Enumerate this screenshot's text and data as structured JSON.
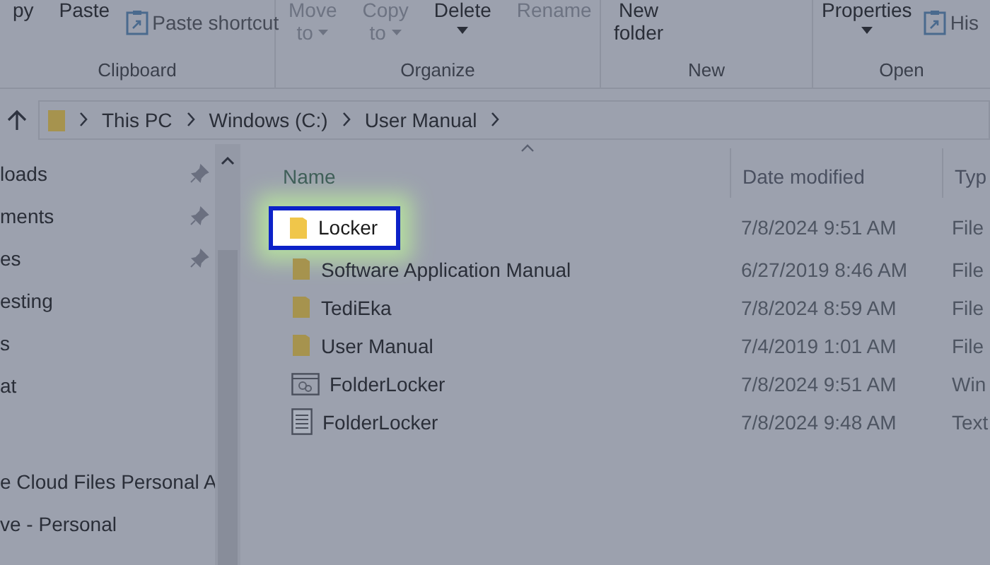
{
  "ribbon": {
    "groups": [
      {
        "label": "Clipboard",
        "commands": [
          {
            "kind": "large",
            "lines": [
              "py"
            ],
            "disabled": false,
            "caret": false
          },
          {
            "kind": "large",
            "lines": [
              "Paste"
            ],
            "disabled": false,
            "caret": false
          },
          {
            "kind": "small",
            "lines": [
              "Paste shortcut"
            ],
            "disabled": false,
            "caret": false
          }
        ]
      },
      {
        "label": "Organize",
        "commands": [
          {
            "kind": "large",
            "lines": [
              "Move",
              "to"
            ],
            "disabled": true,
            "caret": true
          },
          {
            "kind": "large",
            "lines": [
              "Copy",
              "to"
            ],
            "disabled": true,
            "caret": true
          },
          {
            "kind": "large",
            "lines": [
              "Delete"
            ],
            "disabled": false,
            "caret": true
          },
          {
            "kind": "large",
            "lines": [
              "Rename"
            ],
            "disabled": true,
            "caret": false
          }
        ]
      },
      {
        "label": "New",
        "commands": [
          {
            "kind": "large",
            "lines": [
              "New",
              "folder"
            ],
            "disabled": false,
            "caret": false
          }
        ]
      },
      {
        "label": "Open",
        "commands": [
          {
            "kind": "large",
            "lines": [
              "Properties"
            ],
            "disabled": false,
            "caret": true
          },
          {
            "kind": "small",
            "lines": [
              "His"
            ],
            "disabled": false,
            "caret": false
          }
        ]
      }
    ]
  },
  "address_bar": {
    "crumbs": [
      "This PC",
      "Windows (C:)",
      "User Manual"
    ]
  },
  "sidebar": {
    "sections": [
      {
        "items": [
          {
            "label": "loads",
            "pinned": true
          },
          {
            "label": "ments",
            "pinned": true
          },
          {
            "label": "es",
            "pinned": true
          },
          {
            "label": "esting",
            "pinned": false
          },
          {
            "label": "s",
            "pinned": false
          },
          {
            "label": "at",
            "pinned": false
          }
        ]
      },
      {
        "items": [
          {
            "label": "e Cloud Files Personal A",
            "pinned": false
          },
          {
            "label": "ve - Personal",
            "pinned": false
          }
        ]
      }
    ]
  },
  "file_list": {
    "columns": [
      "Name",
      "Date modified",
      "Typ"
    ],
    "rows": [
      {
        "kind": "folder",
        "name": "Locker",
        "date": "7/8/2024 9:51 AM",
        "type": "File",
        "selected": true
      },
      {
        "kind": "folder",
        "name": "Software Application Manual",
        "date": "6/27/2019 8:46 AM",
        "type": "File",
        "selected": false
      },
      {
        "kind": "folder",
        "name": "TediEka",
        "date": "7/8/2024 8:59 AM",
        "type": "File",
        "selected": false
      },
      {
        "kind": "folder",
        "name": "User Manual",
        "date": "7/4/2019 1:01 AM",
        "type": "File",
        "selected": false
      },
      {
        "kind": "app",
        "name": "FolderLocker",
        "date": "7/8/2024 9:51 AM",
        "type": "Win",
        "selected": false
      },
      {
        "kind": "text",
        "name": "FolderLocker",
        "date": "7/8/2024 9:48 AM",
        "type": "Text",
        "selected": false
      }
    ]
  }
}
